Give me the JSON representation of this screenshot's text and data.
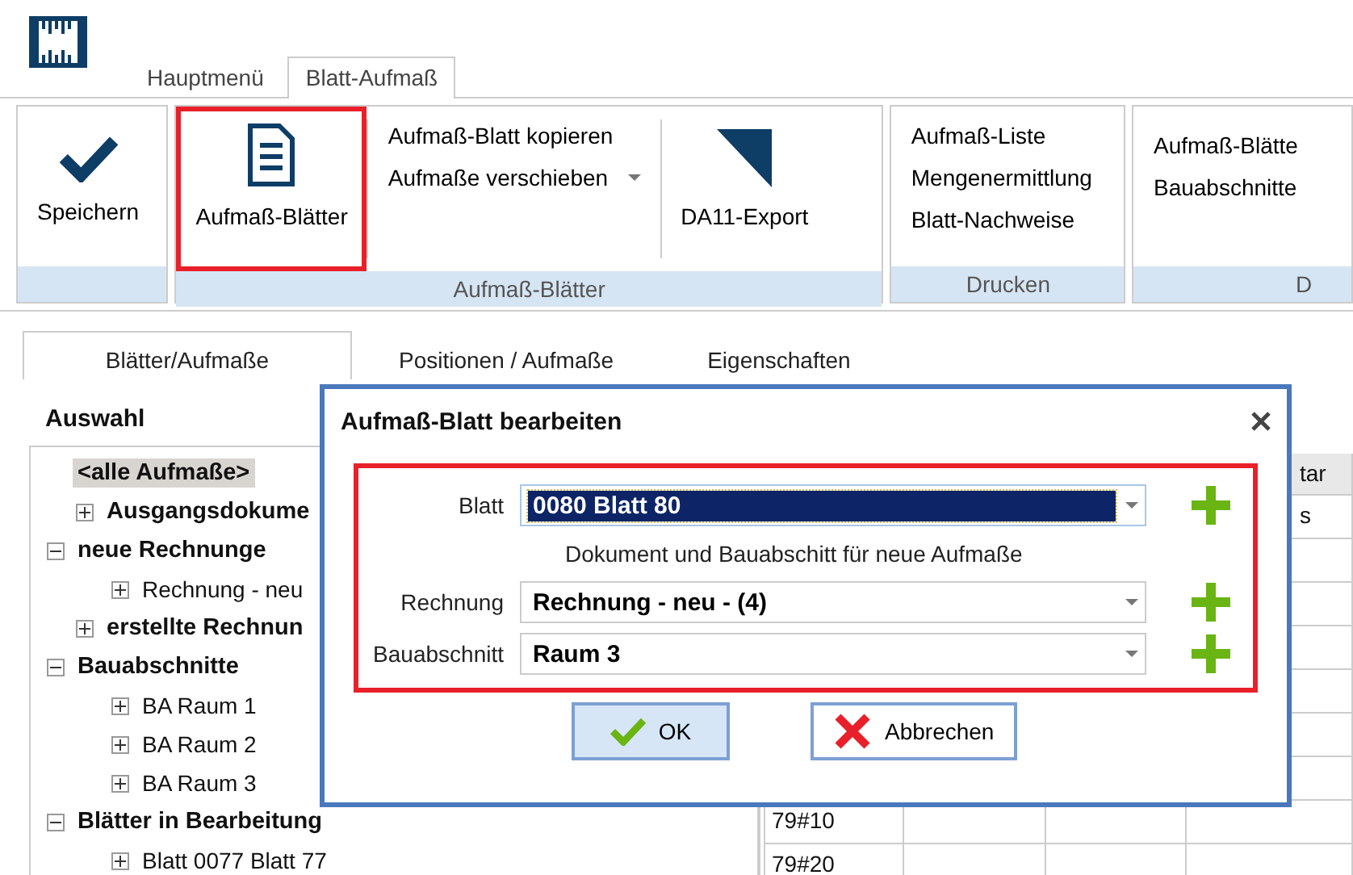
{
  "ribbon_tabs": [
    {
      "label": "Hauptmenü",
      "selected": false
    },
    {
      "label": "Blatt-Aufmaß",
      "selected": true
    }
  ],
  "ribbon": {
    "save": {
      "label": "Speichern"
    },
    "sheets_group": {
      "label": "Aufmaß-Blätter",
      "big_button": "Aufmaß-Blätter",
      "small_buttons": [
        {
          "label": "Aufmaß-Blatt kopieren",
          "kind": "plain"
        },
        {
          "label": "Aufmaße verschieben",
          "kind": "dropdown"
        }
      ],
      "export_button": "DA11-Export"
    },
    "print_group": {
      "label": "Drucken",
      "items": [
        "Aufmaß-Liste",
        "Mengenermittlung",
        "Blatt-Nachweise"
      ]
    },
    "fourth_group": {
      "label": "D",
      "items": [
        "Aufmaß-Blätte",
        "Bauabschnitte"
      ]
    }
  },
  "panel_tabs": [
    {
      "label": "Blätter/Aufmaße",
      "selected": true
    },
    {
      "label": "Positionen / Aufmaße",
      "selected": false
    },
    {
      "label": "Eigenschaften",
      "selected": false
    }
  ],
  "tree": {
    "title": "Auswahl",
    "items": [
      {
        "label": "<alle Aufmaße>",
        "kind": "entry",
        "selected": true
      },
      {
        "label": "Ausgangsdokume",
        "kind": "group",
        "expanded": false,
        "selected": false
      },
      {
        "label": "neue Rechnunge",
        "kind": "group",
        "expanded": true,
        "selected": false,
        "children": [
          {
            "label": "Rechnung - neu",
            "kind": "group",
            "expanded": false,
            "selected": false
          }
        ]
      },
      {
        "label": "erstellte Rechnun",
        "kind": "group",
        "expanded": false,
        "selected": false
      },
      {
        "label": "Bauabschnitte",
        "kind": "group",
        "expanded": true,
        "selected": false,
        "children": [
          {
            "label": "BA Raum 1",
            "kind": "group",
            "expanded": false,
            "selected": false
          },
          {
            "label": "BA Raum 2",
            "kind": "group",
            "expanded": false,
            "selected": false
          },
          {
            "label": "BA Raum 3",
            "kind": "group",
            "expanded": false,
            "selected": false
          }
        ]
      },
      {
        "label": "Blätter in Bearbeitung",
        "kind": "group",
        "expanded": true,
        "selected": false,
        "children": [
          {
            "label": "Blatt 0077 Blatt 77",
            "kind": "group",
            "expanded": false,
            "selected": false
          }
        ]
      }
    ]
  },
  "grid": {
    "header": {
      "column_4": "tar"
    },
    "rows": [
      {
        "column_4": "s"
      },
      {},
      {},
      {},
      {},
      {},
      {},
      {
        "column_1": "79#10"
      },
      {
        "column_1": "79#20"
      }
    ]
  },
  "dialog": {
    "title": "Aufmaß-Blatt bearbeiten",
    "fields": [
      {
        "label": "Blatt",
        "value": "0080 Blatt 80",
        "selected": true
      },
      {
        "kind": "note",
        "text": "Dokument und Bauabschitt für neue Aufmaße"
      },
      {
        "label": "Rechnung",
        "value": "Rechnung - neu - (4)",
        "selected": false
      },
      {
        "label": "Bauabschnitt",
        "value": "Raum 3",
        "selected": false
      }
    ],
    "buttons": [
      {
        "label": "OK",
        "kind": "ok",
        "selected": true
      },
      {
        "label": "Abbrechen",
        "kind": "cancel",
        "selected": false
      }
    ]
  }
}
